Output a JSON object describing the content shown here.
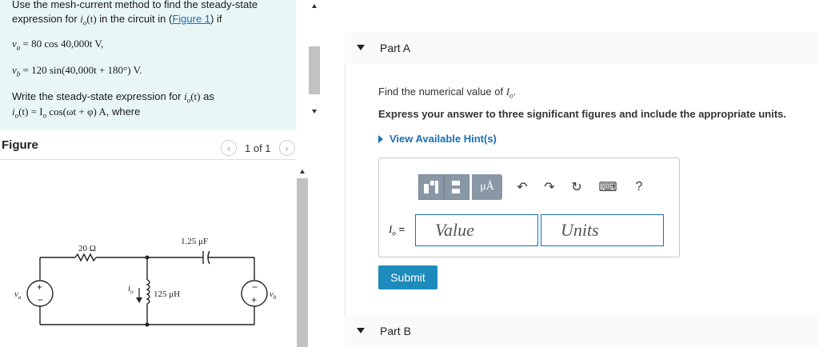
{
  "problem": {
    "intro_prefix": "Use the mesh-current method to find the steady-state",
    "intro_line2_a": "expression for ",
    "intro_var": "i",
    "intro_sub": "o",
    "intro_t": "(t)",
    "intro_line2_b": " in the circuit in (",
    "figure_link": "Figure 1",
    "intro_line2_c": ") if",
    "va_lhs": "v",
    "va_sub": "a",
    "va_rhs": " = 80 cos 40,000t V,",
    "vb_lhs": "v",
    "vb_sub": "b",
    "vb_rhs": " = 120 sin(40,000t + 180°) V.",
    "write_line": "Write the steady-state expression for ",
    "write_var": "i",
    "write_sub": "o",
    "write_t": "(t)",
    "write_as": " as",
    "form_lhs": "i",
    "form_sub": "o",
    "form_rhs": "(t) = I",
    "form_sub2": "o",
    "form_rest": " cos(ωt + φ) A",
    "form_where": ", where"
  },
  "figure": {
    "label": "Figure",
    "page": "1 of 1",
    "prev": "‹",
    "next": "›",
    "r_label": "20 Ω",
    "c_label": "1.25 μF",
    "l_label": "125 μH",
    "va_label": "v",
    "va_sub": "a",
    "vb_label": "v",
    "vb_sub": "b",
    "io_label": "i",
    "io_sub": "o"
  },
  "partA": {
    "title": "Part A",
    "question_prefix": "Find the numerical value of ",
    "question_var": "I",
    "question_sub": "o",
    "question_end": ".",
    "instructions": "Express your answer to three significant figures and include the appropriate units.",
    "hints": "View Available Hint(s)",
    "answer_var": "I",
    "answer_sub": "o",
    "answer_eq": " =",
    "value_placeholder": "Value",
    "units_placeholder": "Units",
    "submit": "Submit",
    "toolbar": {
      "mu_label": "μÅ",
      "undo": "↶",
      "redo": "↷",
      "reset": "↻",
      "keyboard": "⌨",
      "help": "?"
    }
  },
  "partB": {
    "title": "Part B"
  },
  "colors": {
    "problem_bg": "#e9f6f6",
    "accent": "#1a6fb3",
    "submit_bg": "#1d8bbb",
    "toolbar_grey": "#8a97a6"
  }
}
